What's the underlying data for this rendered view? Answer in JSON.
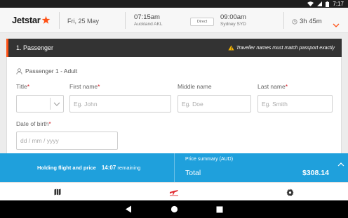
{
  "status_bar": {
    "time": "7:17"
  },
  "flight": {
    "brand": "Jetstar",
    "date": "Fri, 25 May",
    "departure_time": "07:15am",
    "departure_city": "Auckland AKL",
    "stops": "Direct",
    "arrival_time": "09:00am",
    "arrival_city": "Sydney SYD",
    "duration": "3h 45m"
  },
  "passenger_section": {
    "header": "1. Passenger",
    "warning": "Traveller names must match passport exactly",
    "passenger_label": "Passenger 1 - Adult",
    "fields": {
      "title_label": "Title",
      "title_value": "",
      "first_name_label": "First name",
      "first_name_placeholder": "Eg. John",
      "middle_name_label": "Middle name",
      "middle_name_placeholder": "Eg. Doe",
      "last_name_label": "Last name",
      "last_name_placeholder": "Eg. Smith",
      "dob_label": "Date of birth",
      "dob_placeholder": "dd / mm / yyyy",
      "required_marker": "*"
    }
  },
  "price_bar": {
    "holding_text": "Holding flight and price",
    "timer": "14:07",
    "timer_suffix": "remaining",
    "summary_label": "Price summary (AUD)",
    "total_label": "Total",
    "total_value": "$308.14"
  },
  "tabs": [
    {
      "icon": "map-icon"
    },
    {
      "icon": "flight-icon",
      "active": true
    },
    {
      "icon": "settings-icon"
    }
  ],
  "colors": {
    "brand_orange": "#ff5115",
    "header_dark": "#333333",
    "price_bar_blue": "#1fa0dc",
    "required_red": "#d2232a"
  }
}
